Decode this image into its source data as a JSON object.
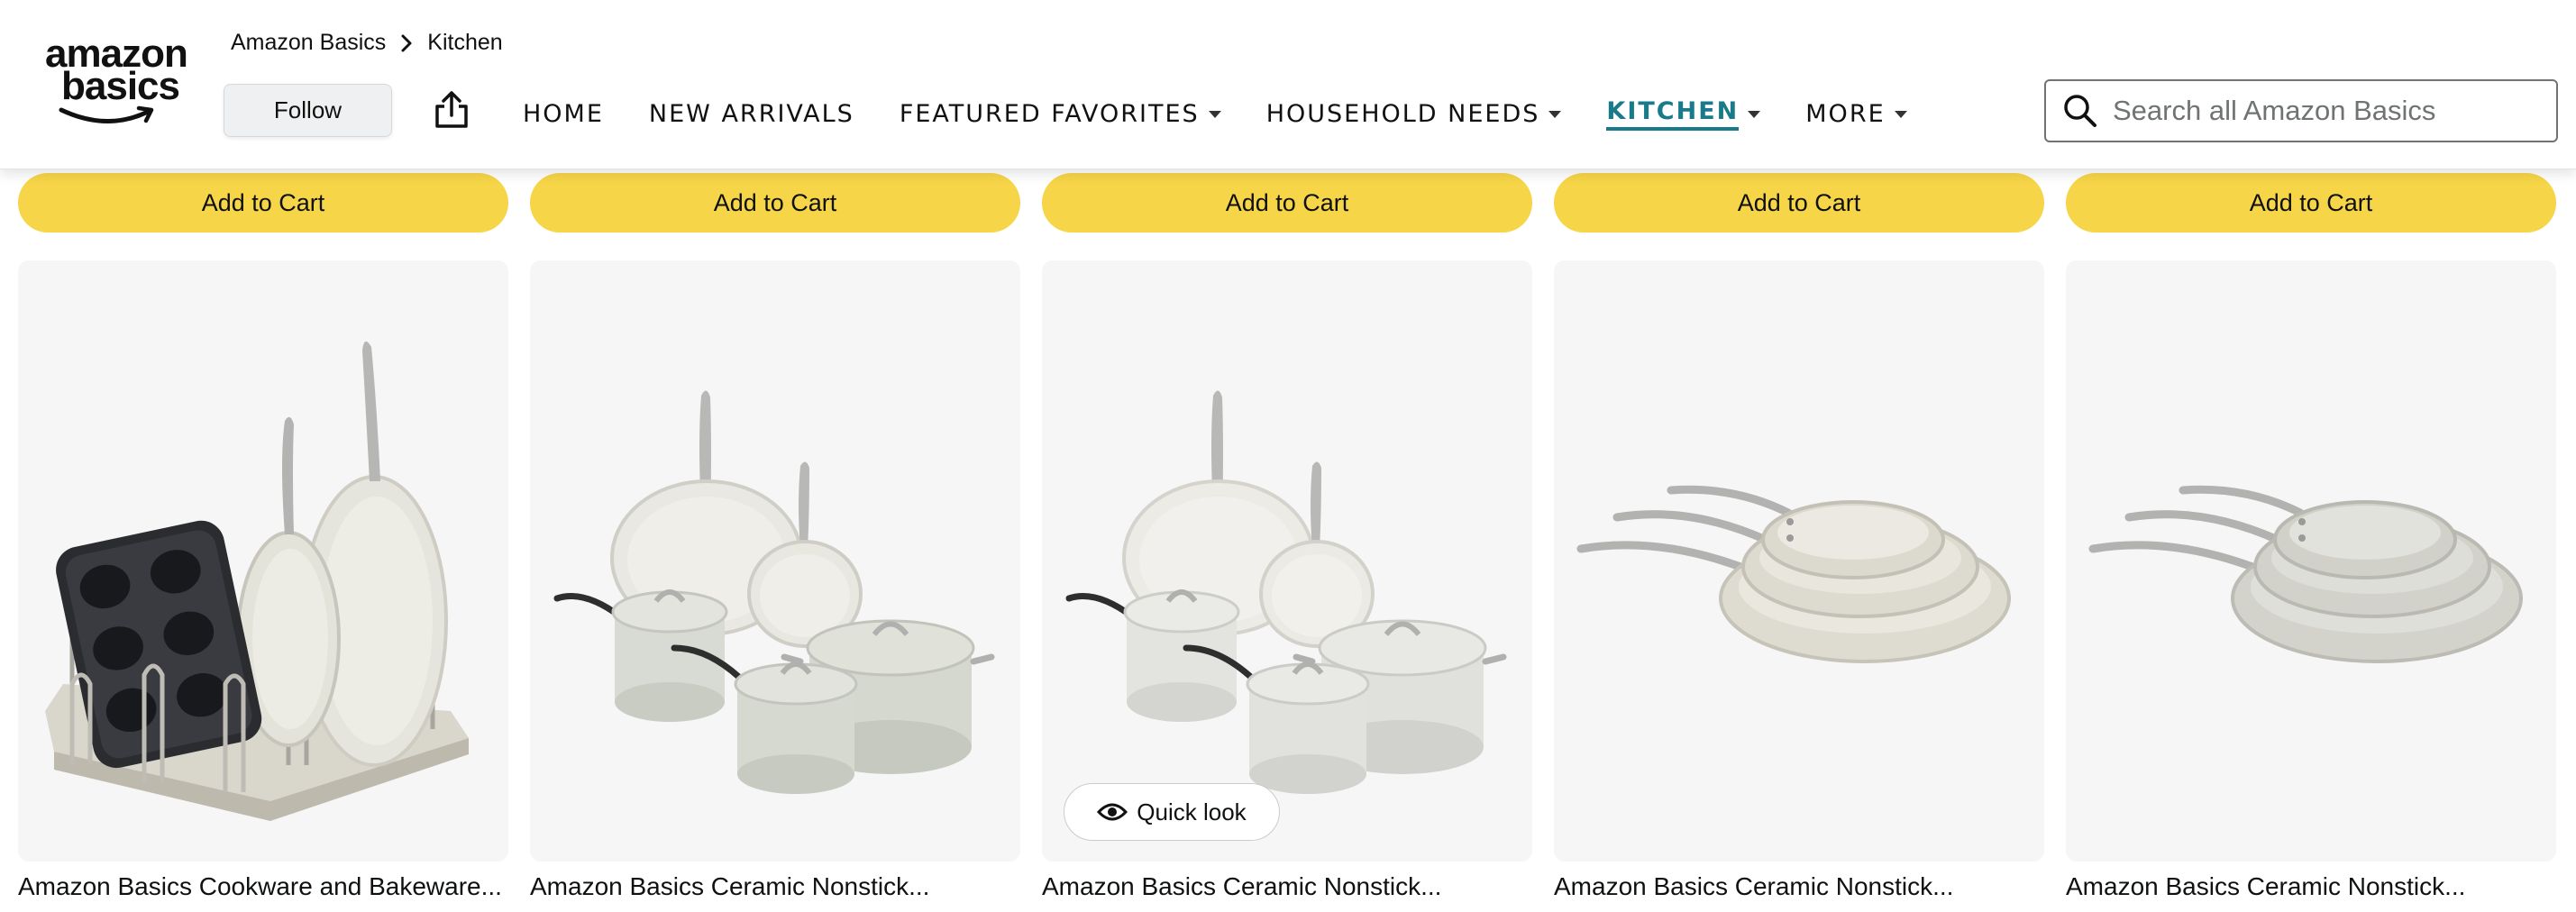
{
  "brand": {
    "logo_line1": "amazon",
    "logo_line2": "basics",
    "logo_icon": "amazon-smile-icon"
  },
  "breadcrumb": {
    "items": [
      "Amazon Basics",
      "Kitchen"
    ],
    "separator_icon": "chevron-right-icon"
  },
  "header": {
    "follow_label": "Follow",
    "share_icon": "share-icon"
  },
  "nav": {
    "items": [
      {
        "label": "HOME",
        "dropdown": false
      },
      {
        "label": "NEW ARRIVALS",
        "dropdown": false
      },
      {
        "label": "FEATURED FAVORITES",
        "dropdown": true
      },
      {
        "label": "HOUSEHOLD NEEDS",
        "dropdown": true
      },
      {
        "label": "KITCHEN",
        "dropdown": true,
        "active": true
      },
      {
        "label": "MORE",
        "dropdown": true
      }
    ],
    "active_color": "#187a8a"
  },
  "search": {
    "placeholder": "Search all Amazon Basics",
    "value": "",
    "icon": "search-icon"
  },
  "cart_buttons": {
    "label": "Add to Cart",
    "color": "#f7d548",
    "count": 5
  },
  "products": [
    {
      "title": "Amazon Basics Cookware and Bakeware...",
      "image": "cookware-bakeware-organizer-rack"
    },
    {
      "title": "Amazon Basics Ceramic Nonstick...",
      "image": "ceramic-nonstick-cookware-set-grey"
    },
    {
      "title": "Amazon Basics Ceramic Nonstick...",
      "image": "ceramic-nonstick-cookware-set-white"
    },
    {
      "title": "Amazon Basics Ceramic Nonstick...",
      "image": "ceramic-nonstick-frying-pan-set-cream"
    },
    {
      "title": "Amazon Basics Ceramic Nonstick...",
      "image": "ceramic-nonstick-frying-pan-set-grey"
    }
  ],
  "quick_look": {
    "label": "Quick look",
    "icon": "eye-icon"
  }
}
